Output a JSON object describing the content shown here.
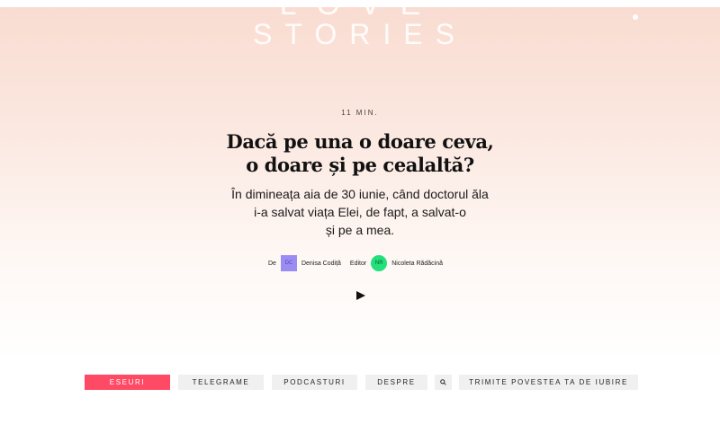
{
  "brand": {
    "logo_top": "LOVE",
    "logo_bottom": "STORIES"
  },
  "article": {
    "read_time": "11 MIN.",
    "title_lines": [
      "Dacă pe una o doare ceva,",
      "o doare și pe cealaltă?"
    ],
    "lead_lines": [
      "În dimineața aia de 30 iunie, când doctorul ăla",
      "i-a salvat viața Elei, de fapt, a salvat-o",
      "și pe a mea."
    ],
    "author_label": "De",
    "author_initials": "DC",
    "author_name": "Denisa Codiță",
    "editor_label": "Editor",
    "editor_initials": "NR",
    "editor_name": "Nicoleta Rădăcină"
  },
  "nav": {
    "items": [
      "ESEURI",
      "TELEGRAME",
      "PODCASTURI",
      "DESPRE"
    ],
    "active": "ESEURI",
    "submit_label": "TRIMITE POVESTEA TA DE IUBIRE"
  },
  "colors": {
    "accent": "#ff4a66",
    "author_avatar": "#9b8cf4",
    "editor_avatar": "#22e07a"
  },
  "icons": {
    "search": "search-icon",
    "play": "play-icon",
    "menu": "menu-dot-icon"
  }
}
